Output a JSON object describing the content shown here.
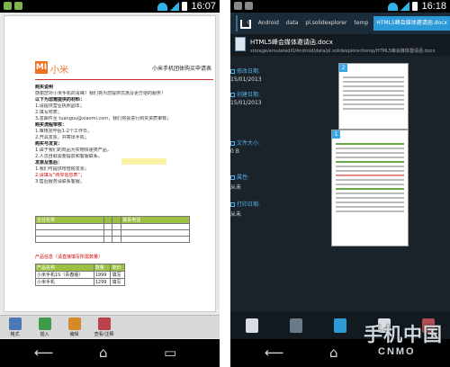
{
  "left": {
    "status": {
      "time": "16:07"
    },
    "document": {
      "brand": "小米",
      "title": "小米手机团体购买申请表",
      "lines": [
        "购买说明",
        "感谢您对小米手机的青睐！我们将为您提供优惠及更方便的服务！",
        "以下为您需提供的材料：",
        "1.请提供营业执照副本；",
        "2.填写附表；",
        "3.发邮件至 tuangou@xiaomi.com，我们将会进行购买资质审核；",
        "购买流程审核：",
        "1.审核完毕后1-2个工作日，",
        "2.开具发票，并寄出手机；",
        "购买与发货：",
        "1.由于我们的商品为实物快递类产品，",
        "2.人员自取需要提前和客服联系。",
        "发票及售后：",
        "1.我们可提供增值税发票；",
        "2.请填写“购买信息表”；",
        "3.售后服务请联系客服。"
      ],
      "table1": {
        "headers": [
          "企业名称",
          "",
          "",
          "联系电话"
        ],
        "rows": [
          [
            "",
            "",
            "",
            ""
          ],
          [
            "",
            "",
            "",
            ""
          ],
          [
            "",
            "",
            "",
            ""
          ]
        ]
      },
      "caption2": "产品信息（请直接填写所需数量）",
      "table2": {
        "headers": [
          "产品名称",
          "数量",
          "单价"
        ],
        "rows": [
          [
            "小米手机1S（青春版）",
            "1999",
            "填写"
          ],
          [
            "小米手机",
            "1299",
            "填写"
          ]
        ]
      }
    },
    "toolbar": [
      {
        "label": "格式",
        "color": "#4a77b8"
      },
      {
        "label": "插入",
        "color": "#3d9a4b"
      },
      {
        "label": "编辑",
        "color": "#d68b2a"
      },
      {
        "label": "查看/注释",
        "color": "#b8434c"
      }
    ]
  },
  "right": {
    "status": {
      "time": "16:18"
    },
    "breadcrumbs": [
      "0",
      "Android",
      "data",
      "pl.solidexplorer",
      "temp",
      "HTML5峰会媒体邀请函.docx"
    ],
    "file": {
      "name": "HTML5峰会媒体邀请函.docx",
      "path": "storage/emulated/0/Android/data/pl.solidexplorer/temp/HTML5峰会媒体邀请函.docx"
    },
    "info": [
      {
        "label": "修改日期:",
        "value": "15/01/2013"
      },
      {
        "label": "创建日期:",
        "value": "15/01/2013"
      },
      {
        "label": "文件大小:",
        "value": "0 B"
      },
      {
        "label": "属性:",
        "value": "从未"
      },
      {
        "label": "打印日期:",
        "value": "从未"
      }
    ],
    "pages": [
      "2",
      "1"
    ],
    "watermark": {
      "main": "手机中国",
      "sub": "CNMO"
    }
  }
}
